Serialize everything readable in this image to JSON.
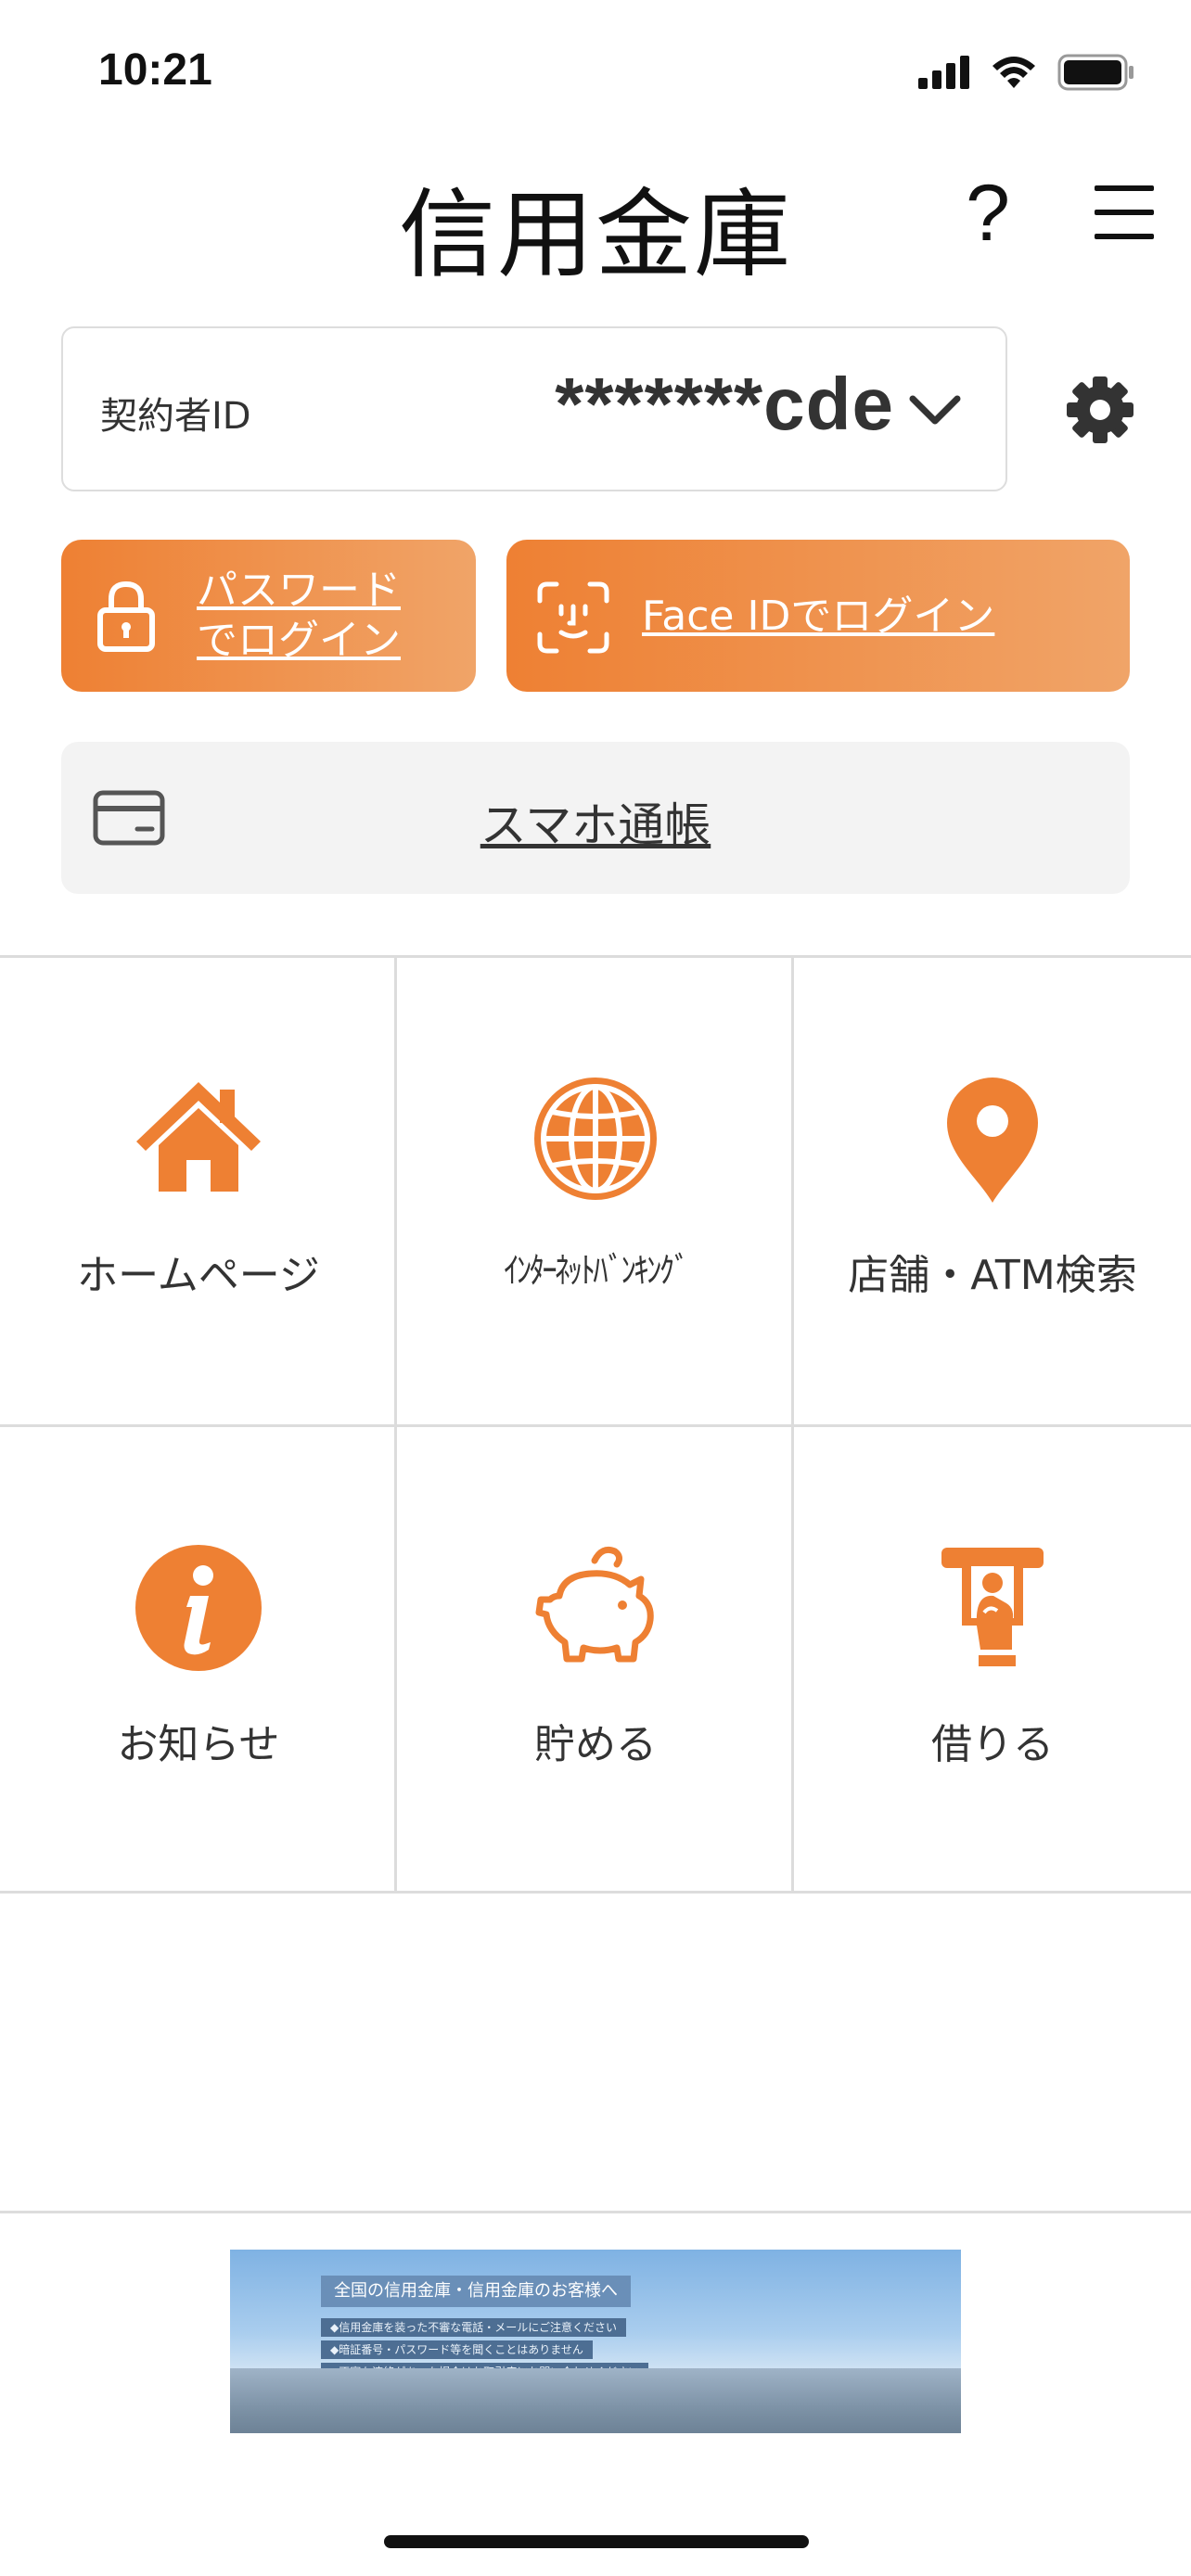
{
  "status_bar": {
    "time": "10:21"
  },
  "header": {
    "title": "信用金庫",
    "help_label": "?"
  },
  "contract": {
    "label": "契約者ID",
    "value": "*******cde"
  },
  "login": {
    "password_line1": "パスワード",
    "password_line2": "でログイン",
    "face_id_label": "Face IDでログイン"
  },
  "passbook": {
    "label": "スマホ通帳"
  },
  "grid": {
    "items": [
      {
        "label": "ホームページ",
        "icon": "home-icon"
      },
      {
        "label": "ｲﾝﾀｰﾈｯﾄﾊﾞﾝｷﾝｸﾞ",
        "icon": "globe-icon"
      },
      {
        "label": "店舗・ATM検索",
        "icon": "map-pin-icon"
      },
      {
        "label": "お知らせ",
        "icon": "info-icon"
      },
      {
        "label": "貯める",
        "icon": "piggy-bank-icon"
      },
      {
        "label": "借りる",
        "icon": "atm-card-icon"
      }
    ]
  },
  "banner": {
    "title": "全国の信用金庫・信用金庫のお客様へ",
    "line1": "◆信用金庫を装った不審な電話・メールにご注意ください",
    "line2": "◆暗証番号・パスワード等を聞くことはありません",
    "line3": "◆不審な連絡があった場合はお取引店にお問い合わせください"
  },
  "colors": {
    "accent": "#ee8033",
    "accent_light": "#f0a468",
    "divider": "#dcdcdc"
  }
}
